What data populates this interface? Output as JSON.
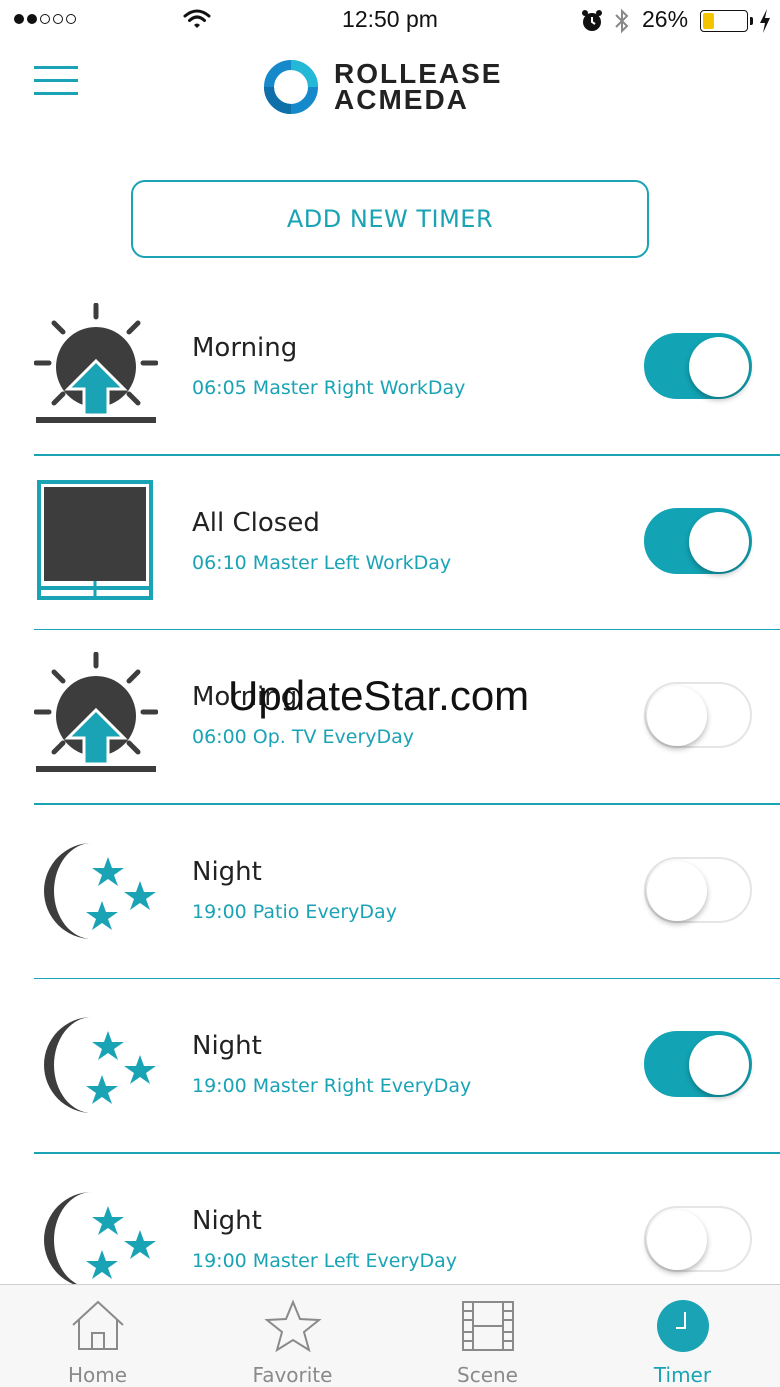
{
  "status_bar": {
    "time": "12:50 pm",
    "battery_percent": "26%",
    "battery_level": 0.26,
    "signal_bars_filled": 2,
    "signal_bars_total": 5,
    "icons": [
      "signal-dots-icon",
      "wifi-icon",
      "alarm-icon",
      "bluetooth-icon",
      "battery-icon",
      "charging-bolt-icon"
    ]
  },
  "header": {
    "menu_icon": "hamburger-menu-icon",
    "logo_line1": "ROLLEASE",
    "logo_line2": "ACMEDA"
  },
  "add_timer_label": "ADD NEW TIMER",
  "timers": [
    {
      "name": "Morning",
      "detail": "06:05 Master Right WorkDay",
      "icon": "sunrise-icon",
      "enabled": true
    },
    {
      "name": "All Closed",
      "detail": "06:10 Master Left WorkDay",
      "icon": "blind-closed-icon",
      "enabled": true
    },
    {
      "name": "Morning",
      "detail": "06:00 Op. TV EveryDay",
      "icon": "sunrise-icon",
      "enabled": false
    },
    {
      "name": "Night",
      "detail": "19:00 Patio EveryDay",
      "icon": "moon-stars-icon",
      "enabled": false
    },
    {
      "name": "Night",
      "detail": "19:00 Master Right EveryDay",
      "icon": "moon-stars-icon",
      "enabled": true
    },
    {
      "name": "Night",
      "detail": "19:00 Master Left EveryDay",
      "icon": "moon-stars-icon",
      "enabled": false
    }
  ],
  "watermark": "UpdateStar.com",
  "tabs": [
    {
      "label": "Home",
      "icon": "home-icon",
      "active": false
    },
    {
      "label": "Favorite",
      "icon": "star-icon",
      "active": false
    },
    {
      "label": "Scene",
      "icon": "film-icon",
      "active": false
    },
    {
      "label": "Timer",
      "icon": "clock-icon",
      "active": true
    }
  ],
  "colors": {
    "accent": "#1aa3b5",
    "toggle_on": "#12a4b4",
    "icon_dark": "#3d3d3d",
    "battery_fill": "#f5c400",
    "tab_inactive": "#8a8a8a"
  }
}
